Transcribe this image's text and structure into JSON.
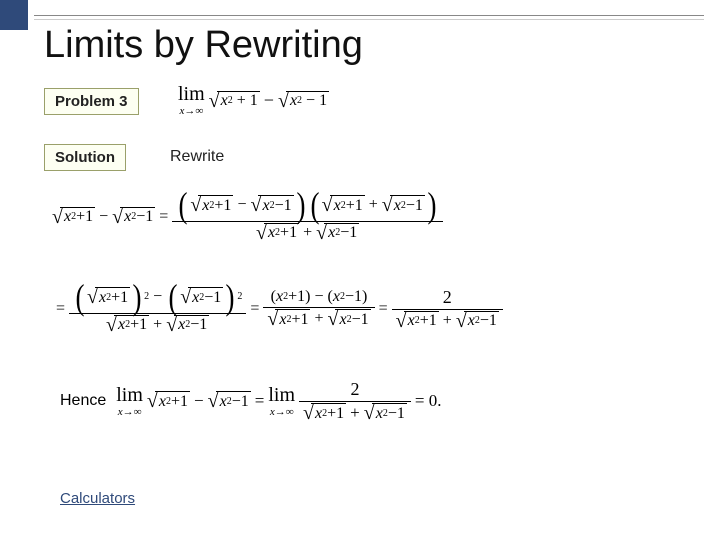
{
  "title": "Limits by Rewriting",
  "labels": {
    "problem": "Problem 3",
    "solution": "Solution",
    "rewrite": "Rewrite",
    "calculators": "Calculators",
    "hence": "Hence"
  },
  "math": {
    "lim_word": "lim",
    "lim_sub": "x→∞",
    "sqrt_xp1": "x² + 1",
    "sqrt_xm1": "x² − 1",
    "xp1": "x² + 1",
    "xm1": "x² − 1",
    "two": "2",
    "eq_zero": "= 0.",
    "equals": "=",
    "minus": "−",
    "plus": "+"
  },
  "chart_data": {
    "type": "table",
    "title": "Limit evaluation by rationalizing the difference of square roots",
    "problem": "lim_{x→∞} ( √(x²+1) − √(x²−1) )",
    "steps": [
      "√(x²+1) − √(x²−1) = ( (√(x²+1) − √(x²−1)) (√(x²+1) + √(x²−1)) ) / ( √(x²+1) + √(x²−1) )",
      "= ( (√(x²+1))² − (√(x²−1))² ) / ( √(x²+1) + √(x²−1) ) = ( (x²+1) − (x²−1) ) / ( √(x²+1) + √(x²−1) ) = 2 / ( √(x²+1) + √(x²−1) )",
      "Hence lim_{x→∞} ( √(x²+1) − √(x²−1) ) = lim_{x→∞} 2 / ( √(x²+1) + √(x²−1) ) = 0."
    ],
    "result": 0
  }
}
